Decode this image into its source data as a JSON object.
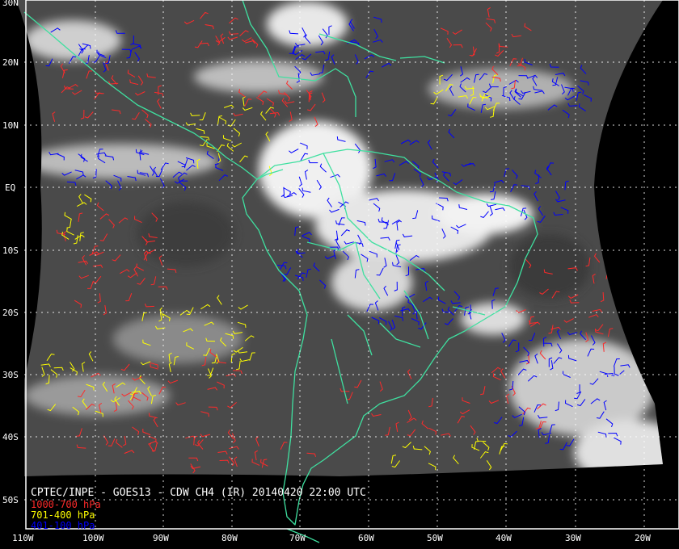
{
  "map": {
    "title": "CPTEC/INPE - GOES13 - CDW CH4 (IR) 20140420 22:00 UTC",
    "latitude_labels": [
      "30N",
      "20N",
      "10N",
      "EQ",
      "10S",
      "20S",
      "30S",
      "40S",
      "50S"
    ],
    "longitude_labels": [
      "110W",
      "100W",
      "90W",
      "80W",
      "70W",
      "60W",
      "50W",
      "40W",
      "30W",
      "20W"
    ],
    "legend": [
      {
        "label": "1000-700 hPa",
        "color": "#ff2a2a"
      },
      {
        "label": "701-400 hPa",
        "color": "#ffff00"
      },
      {
        "label": "401-100 hPa",
        "color": "#0000ff"
      }
    ],
    "colors": {
      "coastline": "#3fe0a0",
      "grid": "#ffffff",
      "background": "#000000"
    }
  }
}
